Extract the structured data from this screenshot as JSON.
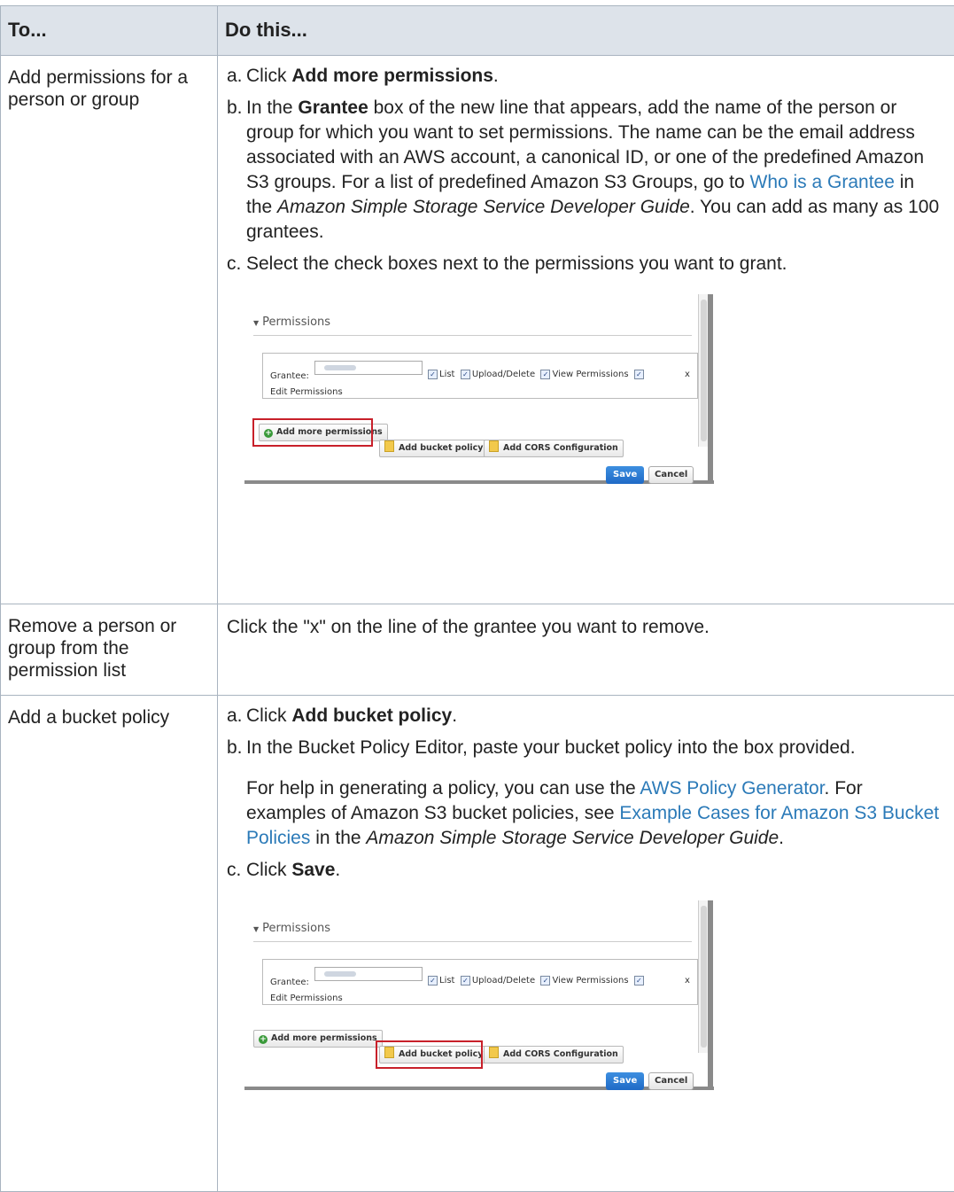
{
  "table": {
    "header_col1": "To...",
    "header_col2": "Do this..."
  },
  "row1": {
    "label": "Add permissions for a person or group",
    "a_prefix": "a. ",
    "a_text1": "Click ",
    "a_bold": "Add more permissions",
    "a_text2": ".",
    "b_prefix": "b. ",
    "b_text1": "In the ",
    "b_bold": "Grantee",
    "b_text2": " box of the new line that appears, add the name of the person or group for which you want to set permissions. The name can be the email address associated with an AWS account, a canonical ID, or one of the predefined Amazon S3 groups. For a list of predefined Amazon S3 Groups, go to ",
    "b_link": "Who is a Grantee",
    "b_text3": " in the ",
    "b_italic": "Amazon Simple Storage Service Developer Guide",
    "b_text4": ". You can add as many as 100 grantees.",
    "c_prefix": "c. ",
    "c_text": "Select the check boxes next to the permissions you want to grant."
  },
  "row2": {
    "label": "Remove a person or group from the permission list",
    "text": "Click the \"x\" on the line of the grantee you want to remove."
  },
  "row3": {
    "label": "Add a bucket policy",
    "a_prefix": "a. ",
    "a_text1": "Click ",
    "a_bold": "Add bucket policy",
    "a_text2": ".",
    "b_prefix": "b. ",
    "b_text": "In the Bucket Policy Editor, paste your bucket policy into the box provided.",
    "p_text1": "For help in generating a policy, you can use the ",
    "p_link1": "AWS Policy Generator",
    "p_text2": ". For examples of Amazon S3 bucket policies, see ",
    "p_link2": "Example Cases for Amazon S3 Bucket Policies",
    "p_text3": " in the ",
    "p_italic": "Amazon Simple Storage Service Developer Guide",
    "p_text4": ".",
    "c_prefix": "c. ",
    "c_text1": "Click ",
    "c_bold": "Save",
    "c_text2": "."
  },
  "screenshot": {
    "section_title": "Permissions",
    "grantee_label": "Grantee:",
    "cb_list": "List",
    "cb_upload": "Upload/Delete",
    "cb_view": "View Permissions",
    "remove_x": "x",
    "edit_permissions": "Edit Permissions",
    "add_more": "Add more permissions",
    "add_bucket_policy": "Add bucket policy",
    "add_cors": "Add CORS Configuration",
    "save": "Save",
    "cancel": "Cancel",
    "check_mark": "✓"
  },
  "colors": {
    "link": "#2b7ab8",
    "header_bg": "#dde3ea",
    "highlight": "#c8202a",
    "save_blue": "#1f6ac6"
  }
}
